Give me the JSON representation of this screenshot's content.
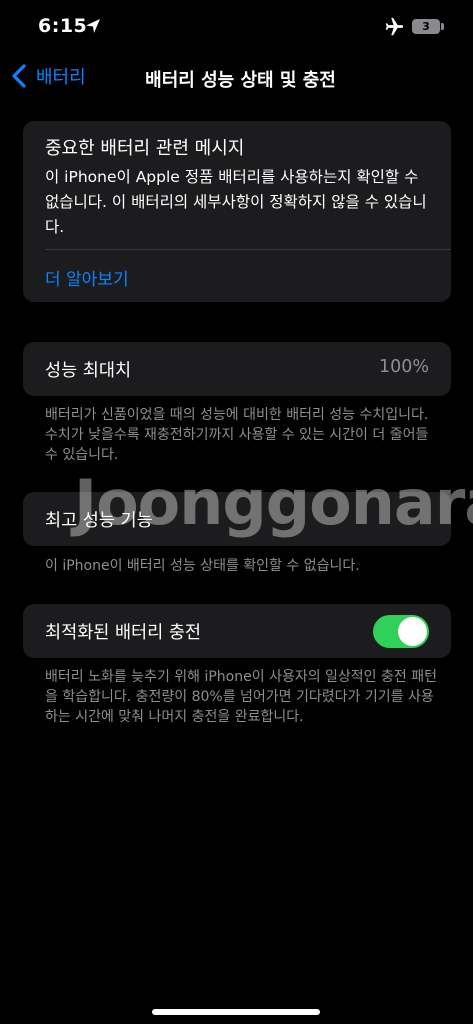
{
  "status_bar": {
    "time": "6:15",
    "battery_level": "3",
    "icons": [
      "location-arrow-icon",
      "airplane-icon",
      "battery-icon"
    ]
  },
  "nav": {
    "back_label": "배터리",
    "title": "배터리 성능 상태 및 충전"
  },
  "message_card": {
    "title": "중요한 배터리 관련 메시지",
    "body": "이 iPhone이 Apple 정품 배터리를 사용하는지 확인할 수 없습니다. 이 배터리의 세부사항이 정확하지 않을 수 있습니다.",
    "link": "더 알아보기"
  },
  "performance": {
    "label": "성능 최대치",
    "value": "100%",
    "footnote": "배터리가 신품이었을 때의 성능에 대비한 배터리 성능 수치입니다. 수치가 낮을수록 재충전하기까지 사용할 수 있는 시간이 더 줄어들 수 있습니다."
  },
  "peak_performance": {
    "label": "최고 성능 기능",
    "footnote": "이 iPhone이 배터리 성능 상태를 확인할 수 없습니다."
  },
  "optimized_charging": {
    "label": "최적화된 배터리 충전",
    "enabled": true,
    "footnote": "배터리 노화를 늦추기 위해 iPhone이 사용자의 일상적인 충전 패턴을 학습합니다. 충전량이 80%를 넘어가면 기다렸다가 기기를 사용하는 시간에 맞춰 나머지 충전을 완료합니다."
  },
  "watermark": "Joonggonara",
  "colors": {
    "accent": "#0a84ff",
    "toggle_on": "#30d158",
    "card_bg": "#1c1c1e",
    "secondary_text": "#8e8e93"
  }
}
